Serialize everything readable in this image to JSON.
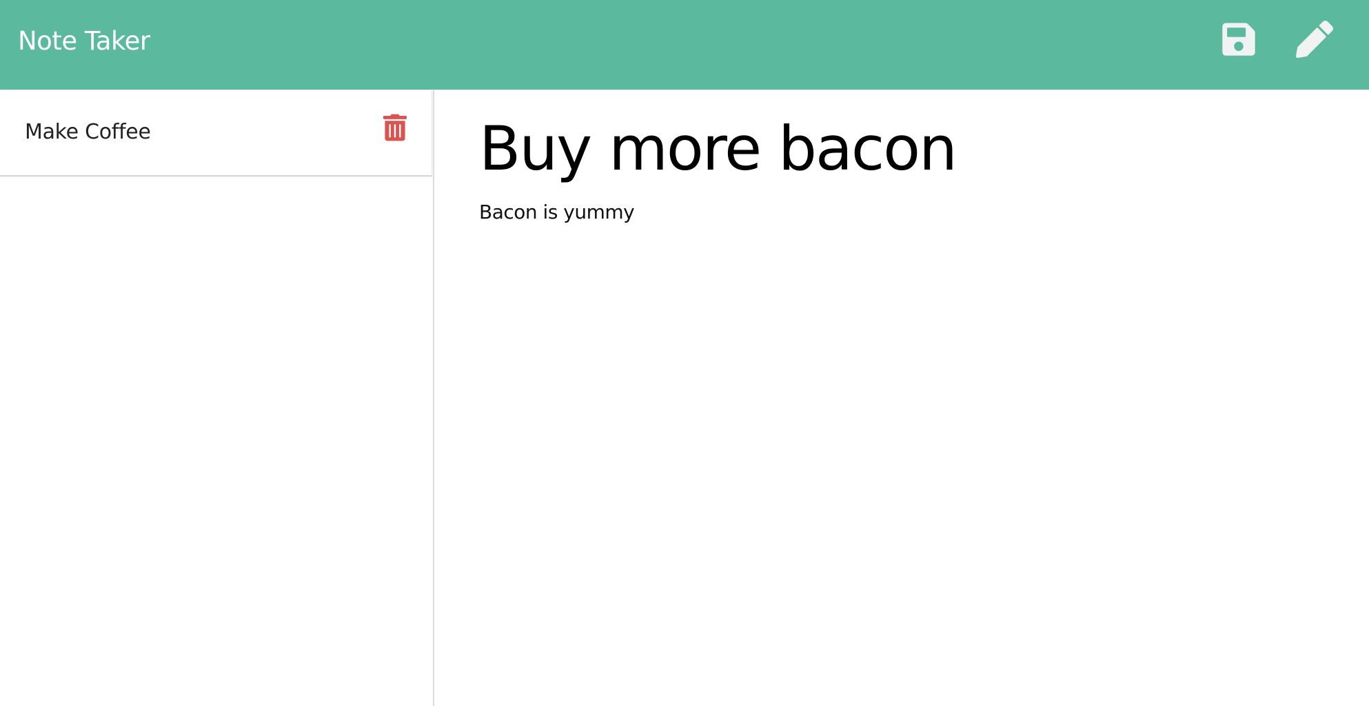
{
  "app": {
    "title": "Note Taker"
  },
  "toolbar": {
    "save_icon": "floppy-disk-icon",
    "new_icon": "pencil-icon"
  },
  "sidebar": {
    "items": [
      {
        "title": "Make Coffee",
        "icon": "trash-icon"
      }
    ]
  },
  "editor": {
    "title": "Buy more bacon",
    "text": "Bacon is yummy"
  },
  "colors": {
    "navbar": "#5bba9d",
    "icon_light": "#f0f3f2",
    "delete": "#d9534f"
  }
}
